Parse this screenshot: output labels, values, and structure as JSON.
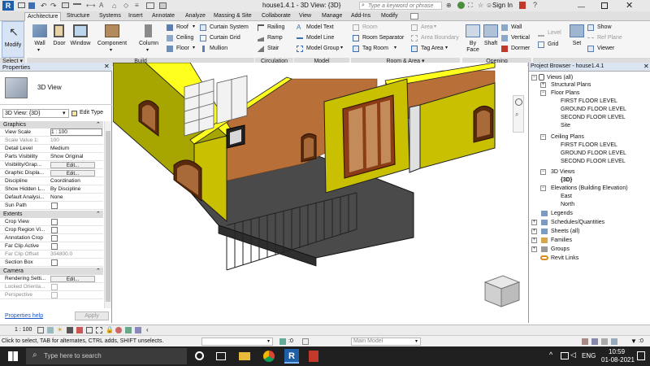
{
  "title_bar": {
    "title": "house1.4.1 - 3D View: {3D}",
    "search_placeholder": "Type a keyword or phrase",
    "sign_in": "Sign In"
  },
  "tabs": [
    {
      "label": "Architecture",
      "active": true
    },
    {
      "label": "Structure"
    },
    {
      "label": "Systems"
    },
    {
      "label": "Insert"
    },
    {
      "label": "Annotate"
    },
    {
      "label": "Analyze"
    },
    {
      "label": "Massing & Site"
    },
    {
      "label": "Collaborate"
    },
    {
      "label": "View"
    },
    {
      "label": "Manage"
    },
    {
      "label": "Add-Ins"
    },
    {
      "label": "Modify"
    }
  ],
  "ribbon": {
    "modify": "Modify",
    "select": "Select",
    "wall": "Wall",
    "door": "Door",
    "window": "Window",
    "component": "Component",
    "column": "Column",
    "roof": "Roof",
    "ceiling": "Ceiling",
    "floor": "Floor",
    "curtain_system": "Curtain System",
    "curtain_grid": "Curtain Grid",
    "mullion": "Mullion",
    "railing": "Railing",
    "ramp": "Ramp",
    "stair": "Stair",
    "model_text": "Model Text",
    "model_line": "Model Line",
    "model_group": "Model Group",
    "room": "Room",
    "room_separator": "Room Separator",
    "tag_room": "Tag Room",
    "area": "Area",
    "area_boundary": "Area Boundary",
    "tag_area": "Tag Area",
    "by_face": "By Face",
    "shaft": "Shaft",
    "opening_wall": "Wall",
    "vertical": "Vertical",
    "dormer": "Dormer",
    "level": "Level",
    "grid": "Grid",
    "set": "Set",
    "show": "Show",
    "ref_plane": "Ref Plane",
    "viewer": "Viewer",
    "panels": {
      "build": "Build",
      "circulation": "Circulation",
      "model": "Model",
      "room_area": "Room & Area",
      "opening": "Opening"
    }
  },
  "properties": {
    "header": "Properties",
    "type_name": "3D View",
    "view_selector": "3D View: {3D}",
    "edit_type": "Edit Type",
    "sections": {
      "graphics": "Graphics",
      "extents": "Extents",
      "camera": "Camera"
    },
    "graphics_rows": [
      {
        "label": "View Scale",
        "value": "1 : 100"
      },
      {
        "label": "Scale Value 1:",
        "value": "100"
      },
      {
        "label": "Detail Level",
        "value": "Medium"
      },
      {
        "label": "Parts Visibility",
        "value": "Show Original"
      },
      {
        "label": "Visibility/Grap...",
        "value": "Edit..."
      },
      {
        "label": "Graphic Displa...",
        "value": "Edit..."
      },
      {
        "label": "Discipline",
        "value": "Coordination"
      },
      {
        "label": "Show Hidden L...",
        "value": "By Discipline"
      },
      {
        "label": "Default Analysi...",
        "value": "None"
      },
      {
        "label": "Sun Path",
        "value": ""
      }
    ],
    "extents_rows": [
      {
        "label": "Crop View"
      },
      {
        "label": "Crop Region Vi..."
      },
      {
        "label": "Annotation Crop"
      },
      {
        "label": "Far Clip Active"
      },
      {
        "label": "Far Clip Offset",
        "value": "304800.0"
      },
      {
        "label": "Section Box"
      }
    ],
    "camera_rows": [
      {
        "label": "Rendering Setti...",
        "value": "Edit..."
      },
      {
        "label": "Locked Orienta..."
      },
      {
        "label": "Perspective"
      }
    ],
    "help_link": "Properties help",
    "apply": "Apply"
  },
  "browser": {
    "header": "Project Browser - house1.4.1",
    "nodes": [
      {
        "label": "Views (all)"
      },
      {
        "label": "Structural Plans"
      },
      {
        "label": "Floor Plans"
      },
      {
        "label": "FIRST FLOOR LEVEL"
      },
      {
        "label": "GROUND FLOOR LEVEL"
      },
      {
        "label": "SECOND FLOOR LEVEL"
      },
      {
        "label": "Site"
      },
      {
        "label": "Ceiling Plans"
      },
      {
        "label": "FIRST FLOOR LEVEL"
      },
      {
        "label": "GROUND FLOOR LEVEL"
      },
      {
        "label": "SECOND FLOOR LEVEL"
      },
      {
        "label": "3D Views"
      },
      {
        "label": "{3D}"
      },
      {
        "label": "Elevations (Building Elevation)"
      },
      {
        "label": "East"
      },
      {
        "label": "North"
      },
      {
        "label": "Legends"
      },
      {
        "label": "Schedules/Quantities"
      },
      {
        "label": "Sheets (all)"
      },
      {
        "label": "Families"
      },
      {
        "label": "Groups"
      },
      {
        "label": "Revit Links"
      }
    ]
  },
  "status": {
    "scale": "1 : 100",
    "model": "Main Model",
    "zero": ":0",
    "hint": "Click to select, TAB for alternates, CTRL adds, SHIFT unselects."
  },
  "taskbar": {
    "search_placeholder": "Type here to search",
    "lang": "ENG",
    "time": "10:59",
    "date": "01-08-2021"
  },
  "colors": {
    "wall_yellow": "#c8c000",
    "wall_olive": "#a7a600",
    "floor_wood": "#b86f38",
    "slab_gray": "#4a4a4a",
    "revit_blue": "#1f5fa8"
  }
}
